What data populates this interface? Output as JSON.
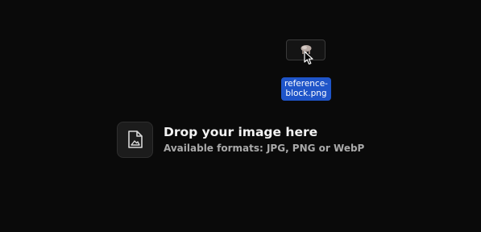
{
  "dragged_file": {
    "name": "reference-block.png",
    "label_color": "#1f55c9",
    "icon": "image-thumbnail-icon"
  },
  "dropzone": {
    "icon": "image-file-icon",
    "title": "Drop your image here",
    "subtitle": "Available formats: JPG, PNG or WebP"
  },
  "colors": {
    "background": "#0a0a0a",
    "title": "#f3f3f3",
    "subtitle": "#a9a9a9"
  }
}
